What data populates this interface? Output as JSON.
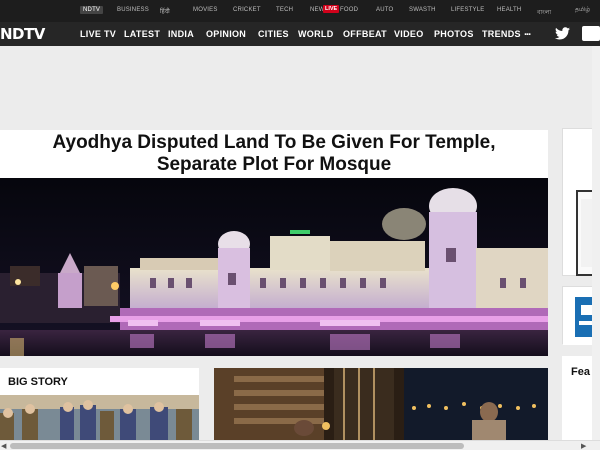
{
  "top_nav": [
    {
      "label": "NDTV",
      "active": true
    },
    {
      "label": "BUSINESS"
    },
    {
      "label": "हिंदी"
    },
    {
      "label": "MOVIES"
    },
    {
      "label": "CRICKET"
    },
    {
      "label": "TECH"
    },
    {
      "label": "NEW"
    },
    {
      "label": "FOOD"
    },
    {
      "label": "AUTO"
    },
    {
      "label": "SWASTH"
    },
    {
      "label": "LIFESTYLE"
    },
    {
      "label": "HEALTH"
    },
    {
      "label": "বাংলা"
    },
    {
      "label": "தமிழ்"
    }
  ],
  "live_badge": "LIVE",
  "logo": "NDTV",
  "main_nav": [
    "LIVE TV",
    "LATEST",
    "INDIA",
    "OPINION",
    "CITIES",
    "WORLD",
    "OFFBEAT",
    "VIDEO",
    "PHOTOS",
    "TRENDS"
  ],
  "more_label": "...",
  "headline": {
    "line1": "Ayodhya Disputed Land To Be Given For Temple,",
    "line2": "Separate Plot For Mosque"
  },
  "big_story_title": "BIG STORY",
  "right_card_title": "Fea",
  "icons": {
    "twitter": "twitter-icon",
    "facebook": "facebook-icon",
    "more": "more-dots-icon"
  },
  "colors": {
    "nav_bg": "#262626",
    "top_nav_bg": "#1d1d1d",
    "live_red": "#d0021b",
    "page_bg": "#ececec"
  }
}
